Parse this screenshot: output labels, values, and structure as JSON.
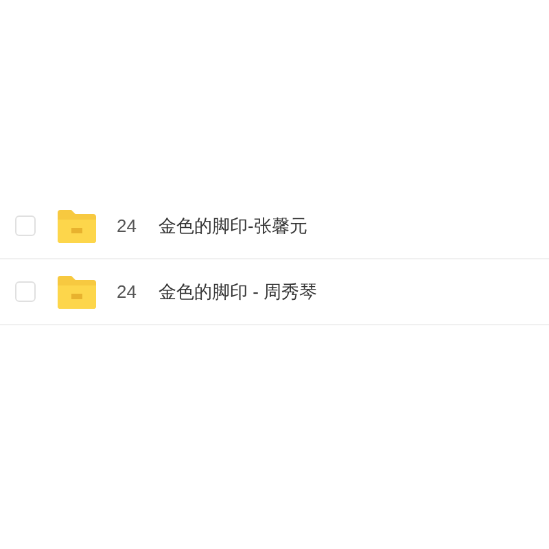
{
  "files": [
    {
      "checked": false,
      "number": "24",
      "name": "金色的脚印-张馨元"
    },
    {
      "checked": false,
      "number": "24",
      "name": "金色的脚印 - 周秀琴"
    }
  ]
}
